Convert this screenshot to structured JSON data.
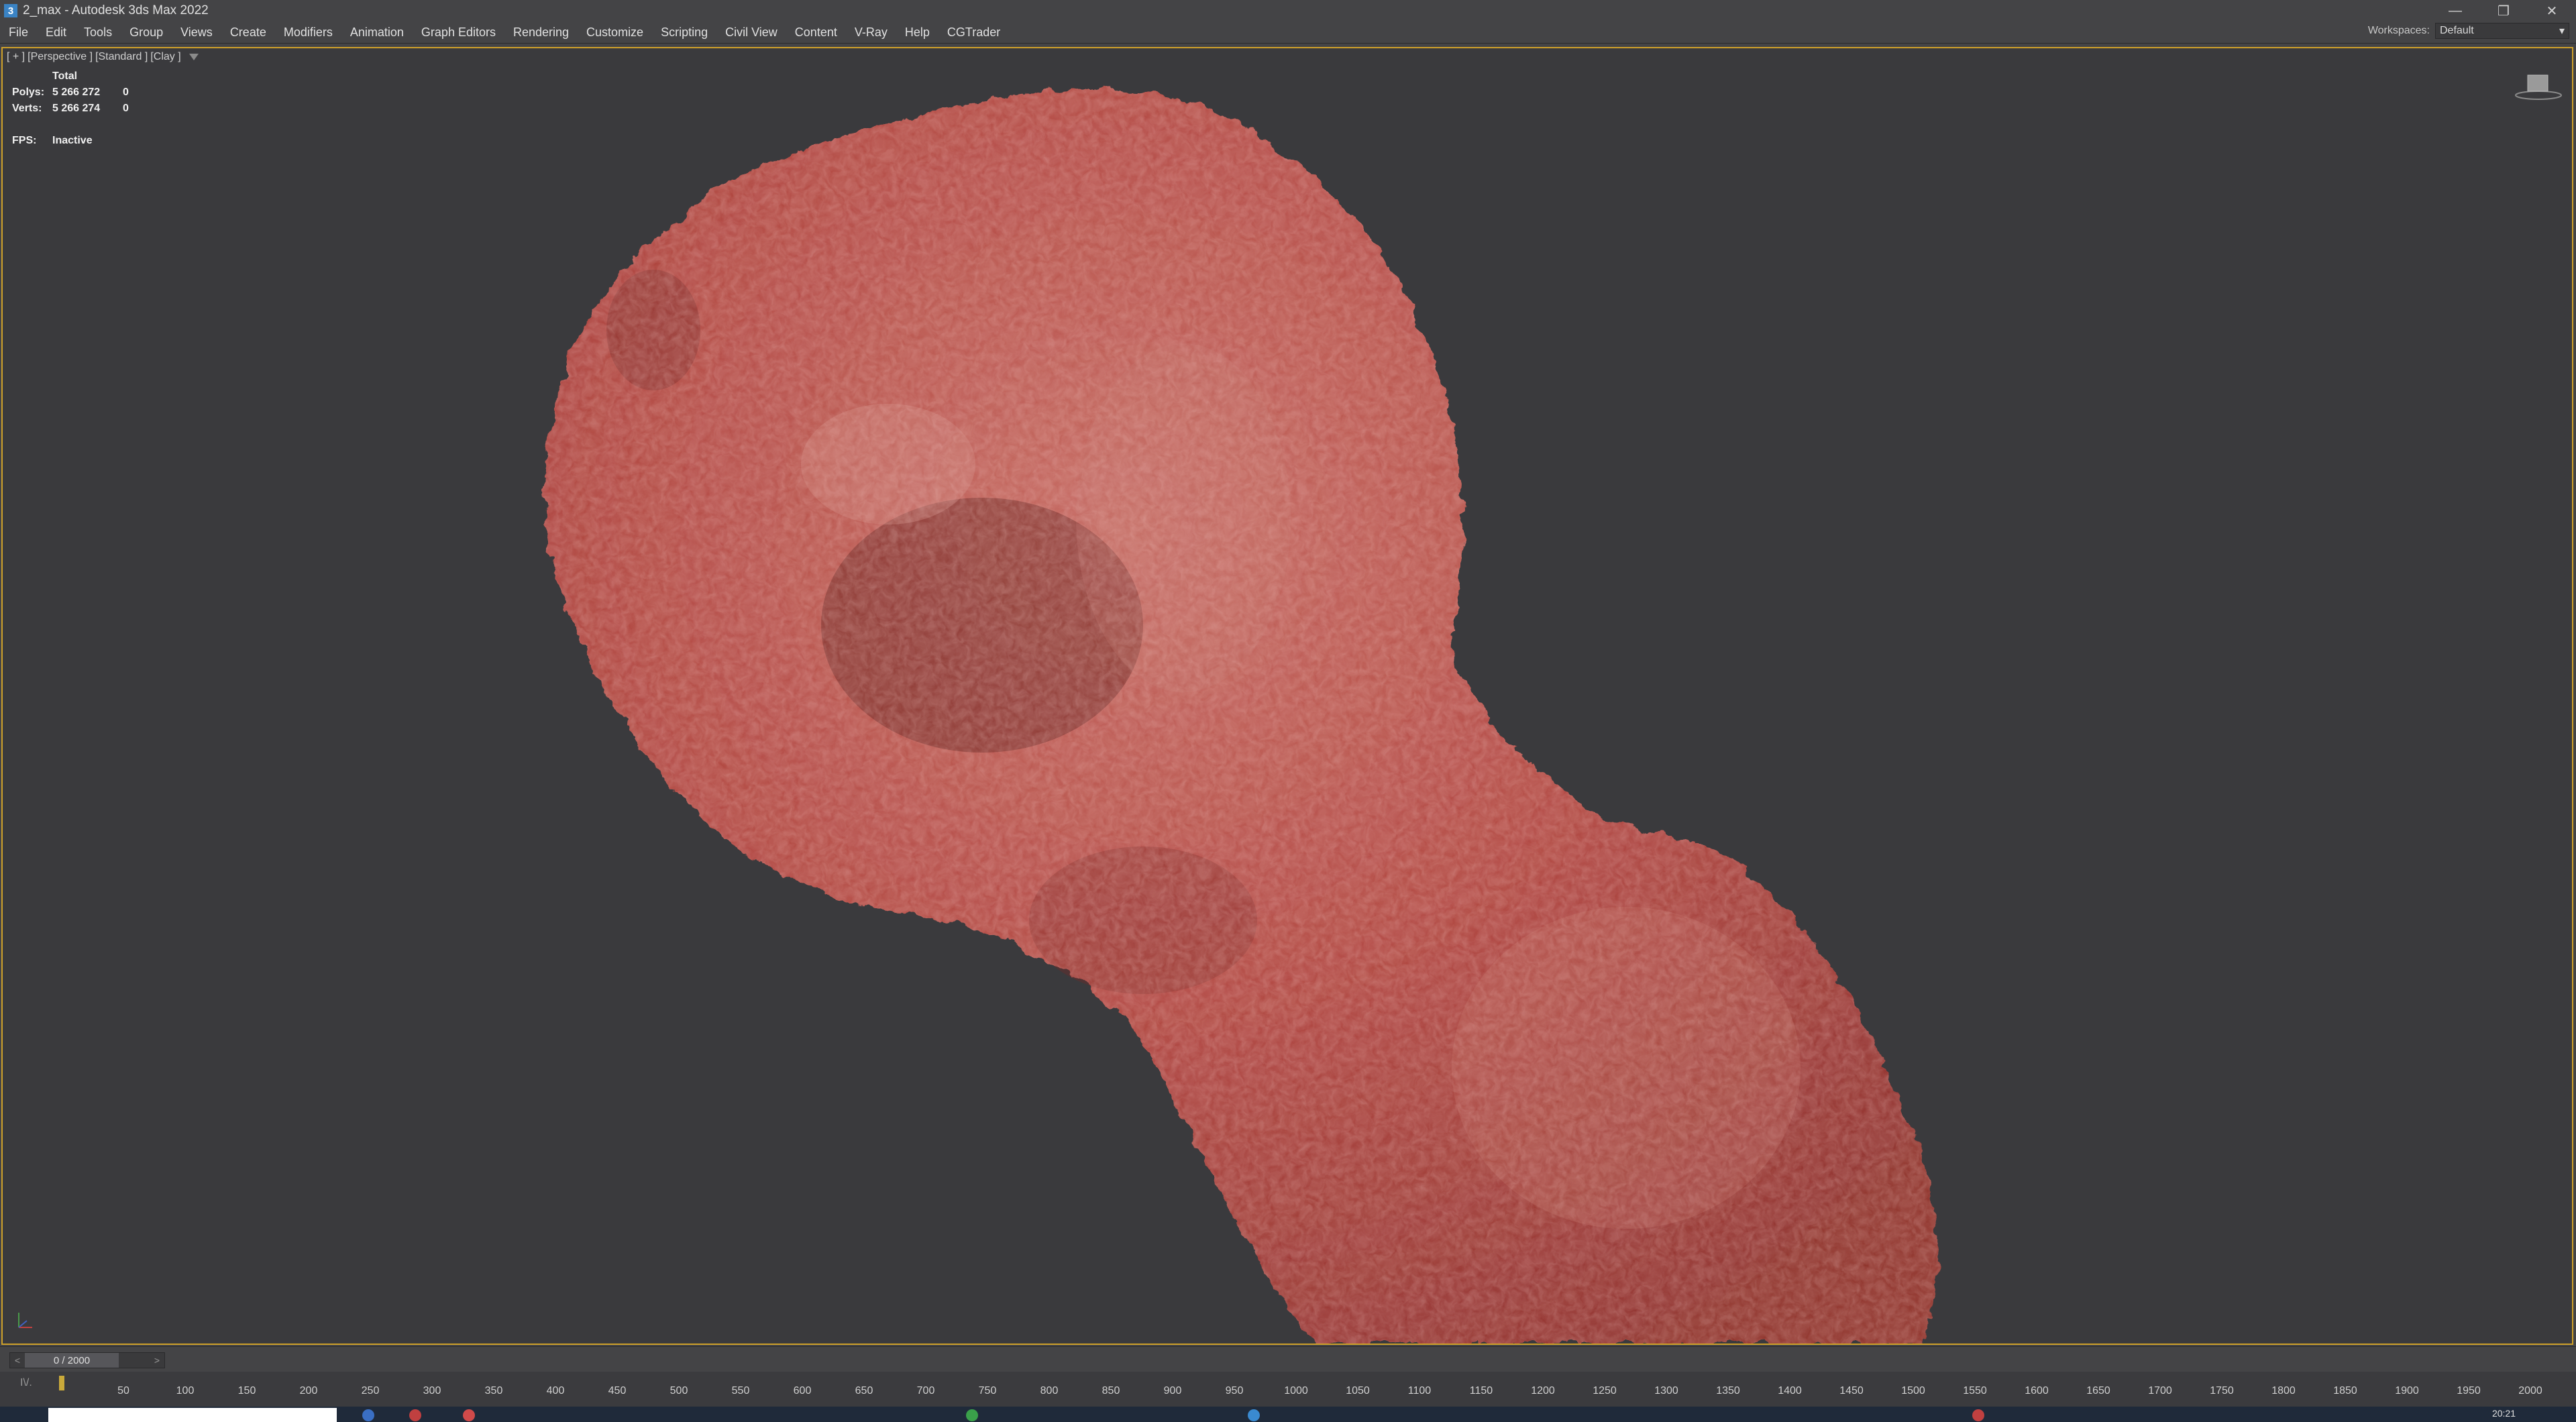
{
  "window": {
    "icon_text": "3",
    "title": "2_max - Autodesk 3ds Max 2022",
    "minimize": "—",
    "restore": "❐",
    "close": "✕"
  },
  "menu": [
    {
      "name": "menu-file",
      "label": "File"
    },
    {
      "name": "menu-edit",
      "label": "Edit"
    },
    {
      "name": "menu-tools",
      "label": "Tools"
    },
    {
      "name": "menu-group",
      "label": "Group"
    },
    {
      "name": "menu-views",
      "label": "Views"
    },
    {
      "name": "menu-create",
      "label": "Create"
    },
    {
      "name": "menu-modifiers",
      "label": "Modifiers"
    },
    {
      "name": "menu-animation",
      "label": "Animation"
    },
    {
      "name": "menu-graph-editors",
      "label": "Graph Editors"
    },
    {
      "name": "menu-rendering",
      "label": "Rendering"
    },
    {
      "name": "menu-customize",
      "label": "Customize"
    },
    {
      "name": "menu-scripting",
      "label": "Scripting"
    },
    {
      "name": "menu-civil-view",
      "label": "Civil View"
    },
    {
      "name": "menu-content",
      "label": "Content"
    },
    {
      "name": "menu-vray",
      "label": "V-Ray"
    },
    {
      "name": "menu-help",
      "label": "Help"
    },
    {
      "name": "menu-cgtrader",
      "label": "CGTrader"
    }
  ],
  "workspace": {
    "label": "Workspaces:",
    "value": "Default"
  },
  "viewport": {
    "label_plus": "[ + ]",
    "label_view": "[Perspective ]",
    "label_shading": "[Standard ]",
    "label_style": "[Clay ]",
    "stats": {
      "header": "Total",
      "polys_label": "Polys:",
      "polys_value": "5 266 272",
      "polys_sel": "0",
      "verts_label": "Verts:",
      "verts_value": "5 266 274",
      "verts_sel": "0",
      "fps_label": "FPS:",
      "fps_value": "Inactive"
    },
    "object_color": "#b84a44",
    "border_color": "#cfa12a"
  },
  "timeline": {
    "frame_display": "0 / 2000",
    "prev": "<",
    "next": ">",
    "track_icon": "I\\/.",
    "ticks": [
      "50",
      "100",
      "150",
      "200",
      "250",
      "300",
      "350",
      "400",
      "450",
      "500",
      "550",
      "600",
      "650",
      "700",
      "750",
      "800",
      "850",
      "900",
      "950",
      "1000",
      "1050",
      "1100",
      "1150",
      "1200",
      "1250",
      "1300",
      "1350",
      "1400",
      "1450",
      "1500",
      "1550",
      "1600",
      "1650",
      "1700",
      "1750",
      "1800",
      "1850",
      "1900",
      "1950",
      "2000"
    ],
    "current_frame": 0,
    "total_frames": 2000
  },
  "taskbar": {
    "time": "20:21"
  }
}
